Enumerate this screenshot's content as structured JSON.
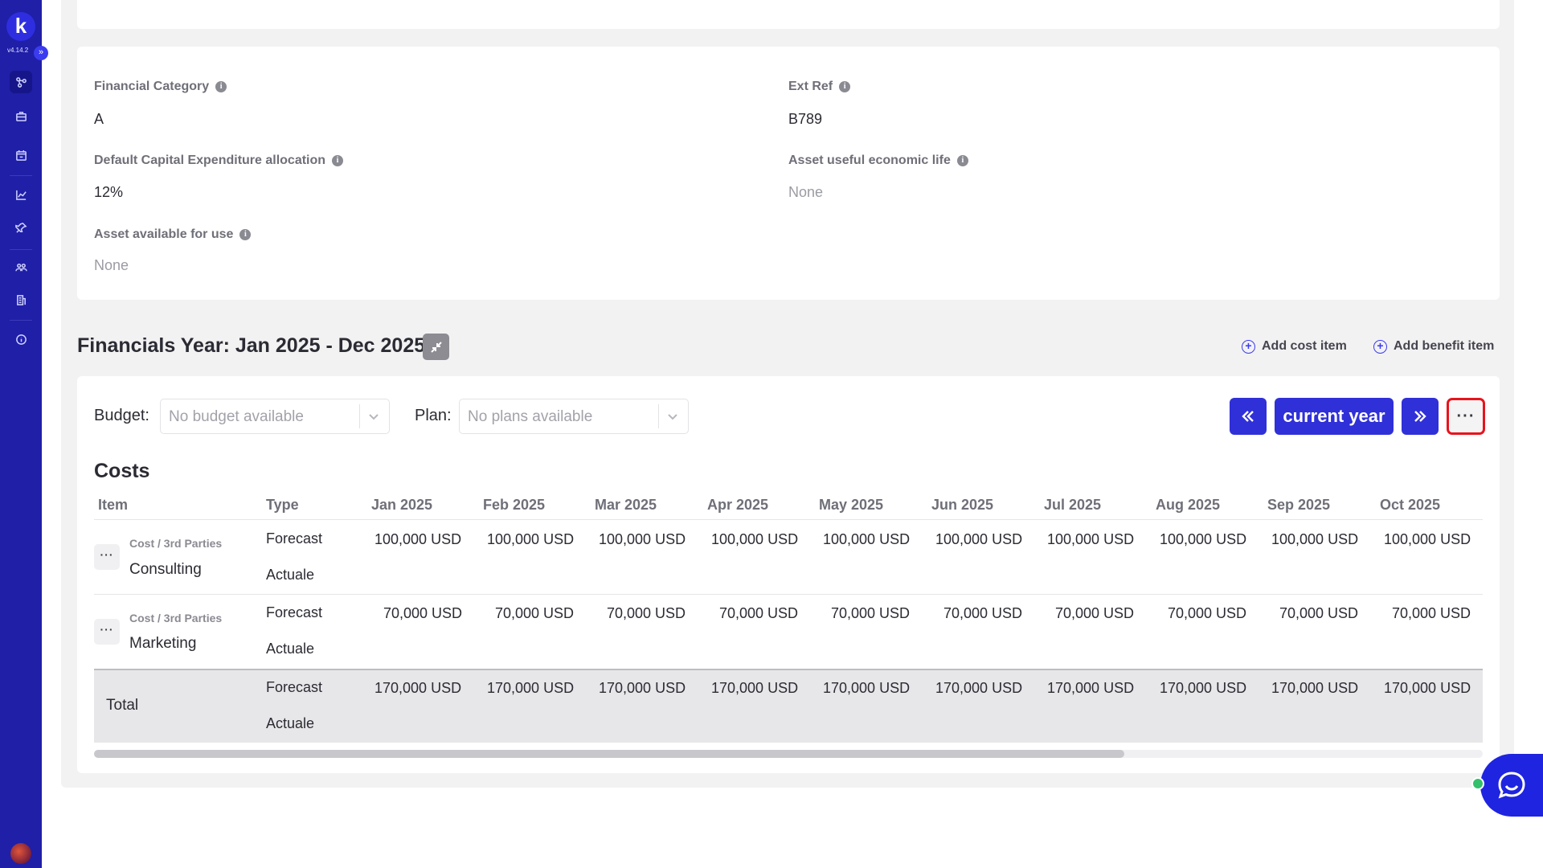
{
  "sidebar": {
    "logo_letter": "k",
    "version": "v4.14.2",
    "expand_glyph": "»",
    "nav_icons": [
      "network-icon",
      "briefcase-icon",
      "calendar-icon",
      "chart-icon",
      "pin-icon",
      "people-icon",
      "building-icon",
      "info-icon"
    ]
  },
  "properties": {
    "financial_category": {
      "label": "Financial Category",
      "value": "A"
    },
    "ext_ref": {
      "label": "Ext Ref",
      "value": "B789"
    },
    "capex_allocation": {
      "label": "Default Capital Expenditure allocation",
      "value": "12%"
    },
    "useful_life": {
      "label": "Asset useful economic life",
      "value": "None"
    },
    "available_for_use": {
      "label": "Asset available for use",
      "value": "None"
    }
  },
  "financials": {
    "title": "Financials Year: Jan 2025 - Dec 2025",
    "add_cost": "Add cost item",
    "add_benefit": "Add benefit item",
    "budget_label": "Budget:",
    "budget_placeholder": "No budget available",
    "plan_label": "Plan:",
    "plan_placeholder": "No plans available",
    "current_year": "current year",
    "more_glyph": "···"
  },
  "costs": {
    "title": "Costs",
    "columns": [
      "Item",
      "Type",
      "Jan 2025",
      "Feb 2025",
      "Mar 2025",
      "Apr 2025",
      "May 2025",
      "Jun 2025",
      "Jul 2025",
      "Aug 2025",
      "Sep 2025",
      "Oct 2025"
    ],
    "rows": [
      {
        "category": "Cost / 3rd Parties",
        "name": "Consulting",
        "forecast_label": "Forecast",
        "actual_label": "Actuale",
        "values": [
          "100,000 USD",
          "100,000 USD",
          "100,000 USD",
          "100,000 USD",
          "100,000 USD",
          "100,000 USD",
          "100,000 USD",
          "100,000 USD",
          "100,000 USD",
          "100,000 USD"
        ]
      },
      {
        "category": "Cost / 3rd Parties",
        "name": "Marketing",
        "forecast_label": "Forecast",
        "actual_label": "Actuale",
        "values": [
          "70,000 USD",
          "70,000 USD",
          "70,000 USD",
          "70,000 USD",
          "70,000 USD",
          "70,000 USD",
          "70,000 USD",
          "70,000 USD",
          "70,000 USD",
          "70,000 USD"
        ]
      }
    ],
    "total": {
      "label": "Total",
      "forecast_label": "Forecast",
      "actual_label": "Actuale",
      "values": [
        "170,000 USD",
        "170,000 USD",
        "170,000 USD",
        "170,000 USD",
        "170,000 USD",
        "170,000 USD",
        "170,000 USD",
        "170,000 USD",
        "170,000 USD",
        "170,000 USD"
      ]
    },
    "row_more_glyph": "···"
  },
  "colors": {
    "sidebar": "#1f1fa8",
    "primary_button": "#3030d8",
    "highlight": "#e8141c",
    "chat": "#1f24e0",
    "online": "#33c06a"
  }
}
